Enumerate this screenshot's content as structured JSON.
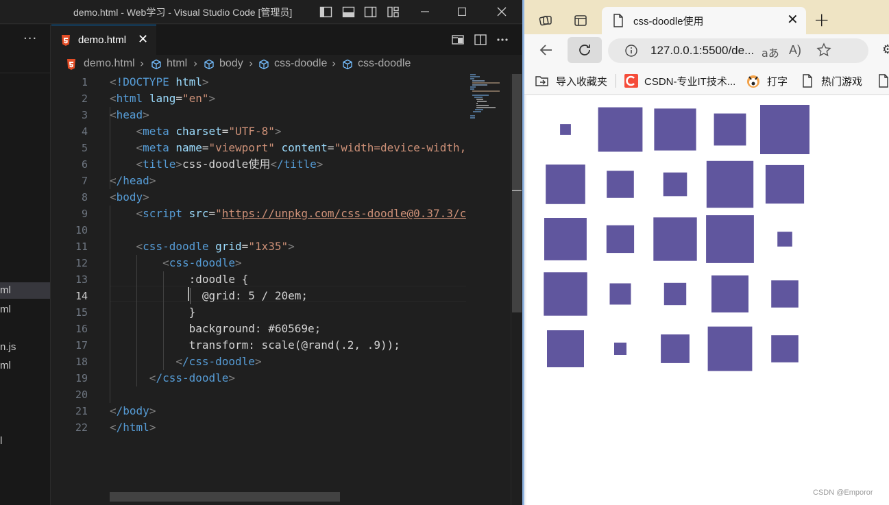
{
  "vscode": {
    "window_title": "demo.html - Web学习 - Visual Studio Code [管理员]",
    "sidebar": {
      "more_label": "···",
      "files": [
        "ml",
        "ml",
        "n.js",
        "ml",
        "l"
      ]
    },
    "tab": {
      "label": "demo.html",
      "close": "✕"
    },
    "breadcrumb": [
      "demo.html",
      "html",
      "body",
      "css-doodle",
      "css-doodle"
    ],
    "current_line": 14,
    "line_numbers": [
      "1",
      "2",
      "3",
      "4",
      "5",
      "6",
      "7",
      "8",
      "9",
      "10",
      "11",
      "12",
      "13",
      "14",
      "15",
      "16",
      "17",
      "18",
      "19",
      "20",
      "21",
      "22"
    ],
    "code": {
      "l1_tag": "!DOCTYPE",
      "l1_kw": "html",
      "l2_tag": "html",
      "l2_attr": "lang",
      "l2_val": "\"en\"",
      "l3_tag": "head",
      "l4_tag": "meta",
      "l4_attr": "charset",
      "l4_val": "\"UTF-8\"",
      "l5_tag": "meta",
      "l5_attr1": "name",
      "l5_val1": "\"viewport\"",
      "l5_attr2": "content",
      "l5_val2": "\"width=device-width,",
      "l6_tag": "title",
      "l6_text": "css-doodle使用",
      "l6_close": "/title",
      "l7_tag": "/head",
      "l8_tag": "body",
      "l9_tag": "script",
      "l9_attr": "src",
      "l9_val": "https://unpkg.com/css-doodle@0.37.3/c",
      "l11_tag": "css-doodle",
      "l11_attr": "grid",
      "l11_val": "\"1x35\"",
      "l12_tag": "css-doodle",
      "l13_text": ":doodle {",
      "l14_text": "@grid: 5 / 20em;",
      "l15_text": "}",
      "l16_text": "background: #60569e;",
      "l17_text": "transform: scale(@rand(.2, .9));",
      "l18_tag": "/css-doodle",
      "l19_tag": "/css-doodle",
      "l21_tag": "/body",
      "l22_tag": "/html"
    }
  },
  "browser": {
    "tab_title": "css-doodle使用",
    "tab_close": "✕",
    "new_tab": "+",
    "url": "127.0.0.1:5500/de...",
    "read_mode_label": "aあ",
    "read_aloud_label": "A)",
    "favorites": [
      "导入收藏夹",
      "CSDN-专业IT技术...",
      "打字",
      "热门游戏"
    ],
    "doodle_color": "#60569e",
    "doodle_scales": [
      0.22,
      0.9,
      0.85,
      0.65,
      1.0,
      0.8,
      0.55,
      0.48,
      0.95,
      0.78,
      0.86,
      0.56,
      0.88,
      0.97,
      0.3,
      0.88,
      0.43,
      0.45,
      0.75,
      0.55,
      0.75,
      0.25,
      0.58,
      0.9,
      0.55
    ],
    "watermark": "CSDN @Emporor"
  }
}
